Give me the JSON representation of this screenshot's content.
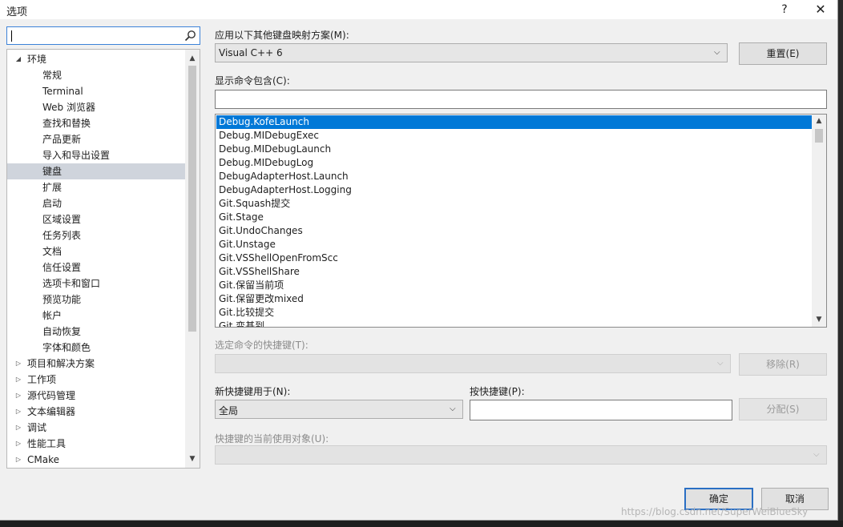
{
  "window": {
    "title": "选项",
    "help": "?",
    "close": "✕"
  },
  "search": {
    "value": ""
  },
  "tree": {
    "items": [
      {
        "label": "环境",
        "arrow": "◢",
        "expanded": true
      },
      {
        "label": "常规"
      },
      {
        "label": "Terminal"
      },
      {
        "label": "Web 浏览器"
      },
      {
        "label": "查找和替换"
      },
      {
        "label": "产品更新"
      },
      {
        "label": "导入和导出设置"
      },
      {
        "label": "键盘"
      },
      {
        "label": "扩展"
      },
      {
        "label": "启动"
      },
      {
        "label": "区域设置"
      },
      {
        "label": "任务列表"
      },
      {
        "label": "文档"
      },
      {
        "label": "信任设置"
      },
      {
        "label": "选项卡和窗口"
      },
      {
        "label": "预览功能"
      },
      {
        "label": "帐户"
      },
      {
        "label": "自动恢复"
      },
      {
        "label": "字体和颜色"
      },
      {
        "label": "项目和解决方案",
        "arrow": "▷"
      },
      {
        "label": "工作项",
        "arrow": "▷"
      },
      {
        "label": "源代码管理",
        "arrow": "▷"
      },
      {
        "label": "文本编辑器",
        "arrow": "▷"
      },
      {
        "label": "调试",
        "arrow": "▷"
      },
      {
        "label": "性能工具",
        "arrow": "▷"
      },
      {
        "label": "CMake",
        "arrow": "▷"
      }
    ],
    "selected_index": 7
  },
  "mapping": {
    "label": "应用以下其他键盘映射方案(M):",
    "value": "Visual C++ 6",
    "reset": "重置(E)"
  },
  "show_commands": {
    "label": "显示命令包含(C):",
    "value": ""
  },
  "commands": {
    "items": [
      "Debug.KofeLaunch",
      "Debug.MIDebugExec",
      "Debug.MIDebugLaunch",
      "Debug.MIDebugLog",
      "DebugAdapterHost.Launch",
      "DebugAdapterHost.Logging",
      "Git.Squash提交",
      "Git.Stage",
      "Git.UndoChanges",
      "Git.Unstage",
      "Git.VSShellOpenFromScc",
      "Git.VSShellShare",
      "Git.保留当前项",
      "Git.保留更改mixed",
      "Git.比较提交",
      "Git.变基到"
    ],
    "selected_index": 0
  },
  "shortcuts": {
    "label": "选定命令的快捷键(T):",
    "remove": "移除(R)"
  },
  "new_shortcut": {
    "label": "新快捷键用于(N):",
    "value": "全局"
  },
  "press_shortcut": {
    "label": "按快捷键(P):",
    "value": "",
    "assign": "分配(S)"
  },
  "used_by": {
    "label": "快捷键的当前使用对象(U):"
  },
  "footer": {
    "ok": "确定",
    "cancel": "取消"
  },
  "watermark": "https://blog.csdn.net/SuperWeiBlueSky",
  "colors": {
    "selection": "#0078d7",
    "tree_selection": "#cfd4dc",
    "primary_border": "#2a6fc4"
  }
}
